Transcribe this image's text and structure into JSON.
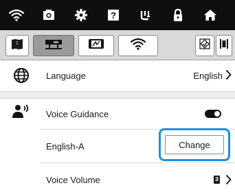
{
  "top_nav": {
    "items": [
      {
        "icon": "wifi-icon"
      },
      {
        "icon": "camera-icon"
      },
      {
        "icon": "gear-icon"
      },
      {
        "icon": "help-icon"
      },
      {
        "icon": "needle-icon"
      },
      {
        "icon": "lock-icon"
      },
      {
        "icon": "home-icon"
      }
    ]
  },
  "settings_tabs": {
    "items": [
      {
        "icon": "book-icon"
      },
      {
        "icon": "sewing-machine-icon"
      },
      {
        "icon": "embroidery-frame-icon"
      },
      {
        "icon": "wifi-icon"
      }
    ],
    "active_index": 1
  },
  "settings": {
    "language": {
      "label": "Language",
      "value": "English",
      "icon": "globe-icon"
    },
    "voice_guidance": {
      "label": "Voice Guidance",
      "icon": "voice-icon",
      "enabled": true
    },
    "voice": {
      "label": "English-A",
      "button_label": "Change"
    },
    "voice_volume": {
      "label": "Voice Volume",
      "value": "3"
    }
  },
  "colors": {
    "top_bar": "#0f0f0f",
    "tab_bar": "#d9d9d9",
    "highlight": "#1e8fe3"
  }
}
